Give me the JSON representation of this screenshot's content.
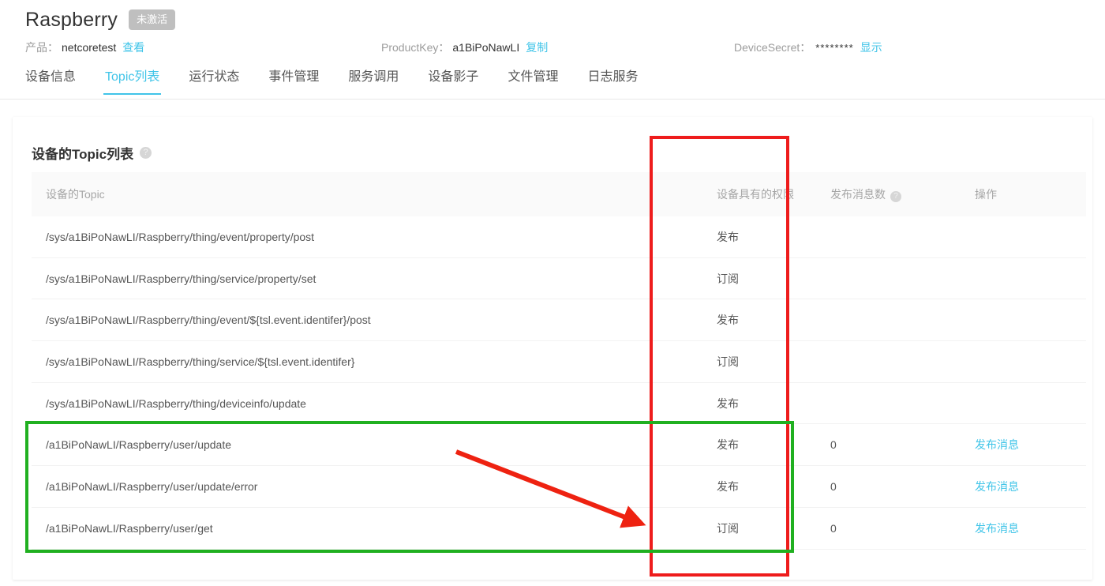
{
  "header": {
    "device_name": "Raspberry",
    "status_badge": "未激活",
    "product_label": "产品：",
    "product_name": "netcoretest",
    "product_link": "查看",
    "product_key_label": "ProductKey：",
    "product_key_value": "a1BiPoNawLI",
    "product_key_action": "复制",
    "device_secret_label": "DeviceSecret：",
    "device_secret_value": "********",
    "device_secret_action": "显示"
  },
  "tabs": [
    {
      "label": "设备信息",
      "active": false
    },
    {
      "label": "Topic列表",
      "active": true
    },
    {
      "label": "运行状态",
      "active": false
    },
    {
      "label": "事件管理",
      "active": false
    },
    {
      "label": "服务调用",
      "active": false
    },
    {
      "label": "设备影子",
      "active": false
    },
    {
      "label": "文件管理",
      "active": false
    },
    {
      "label": "日志服务",
      "active": false
    }
  ],
  "card": {
    "title": "设备的Topic列表",
    "title_help_icon": "?"
  },
  "table": {
    "columns": [
      {
        "key": "topic",
        "label": "设备的Topic",
        "help": false
      },
      {
        "key": "permission",
        "label": "设备具有的权限",
        "help": false
      },
      {
        "key": "count",
        "label": "发布消息数",
        "help": true
      },
      {
        "key": "ops",
        "label": "操作",
        "help": false
      }
    ],
    "help_glyph": "?",
    "rows": [
      {
        "topic": "/sys/a1BiPoNawLI/Raspberry/thing/event/property/post",
        "permission": "发布",
        "count": "",
        "op": ""
      },
      {
        "topic": "/sys/a1BiPoNawLI/Raspberry/thing/service/property/set",
        "permission": "订阅",
        "count": "",
        "op": ""
      },
      {
        "topic": "/sys/a1BiPoNawLI/Raspberry/thing/event/${tsl.event.identifer}/post",
        "permission": "发布",
        "count": "",
        "op": ""
      },
      {
        "topic": "/sys/a1BiPoNawLI/Raspberry/thing/service/${tsl.event.identifer}",
        "permission": "订阅",
        "count": "",
        "op": ""
      },
      {
        "topic": "/sys/a1BiPoNawLI/Raspberry/thing/deviceinfo/update",
        "permission": "发布",
        "count": "",
        "op": ""
      },
      {
        "topic": "/a1BiPoNawLI/Raspberry/user/update",
        "permission": "发布",
        "count": "0",
        "op": "发布消息"
      },
      {
        "topic": "/a1BiPoNawLI/Raspberry/user/update/error",
        "permission": "发布",
        "count": "0",
        "op": "发布消息"
      },
      {
        "topic": "/a1BiPoNawLI/Raspberry/user/get",
        "permission": "订阅",
        "count": "0",
        "op": "发布消息"
      }
    ]
  },
  "annotations": {
    "red_color": "#ee1c1c",
    "green_color": "#20b020",
    "red_box_target": "设备具有的权限",
    "green_box_target": "user-topic-rows",
    "arrow_color": "#ee2211"
  },
  "colors": {
    "accent": "#40c4e8",
    "text_primary": "#333333",
    "text_secondary": "#999999",
    "badge_bg": "#bfbfbf",
    "header_bg": "#fafafa",
    "page_bg": "#ffffff"
  }
}
